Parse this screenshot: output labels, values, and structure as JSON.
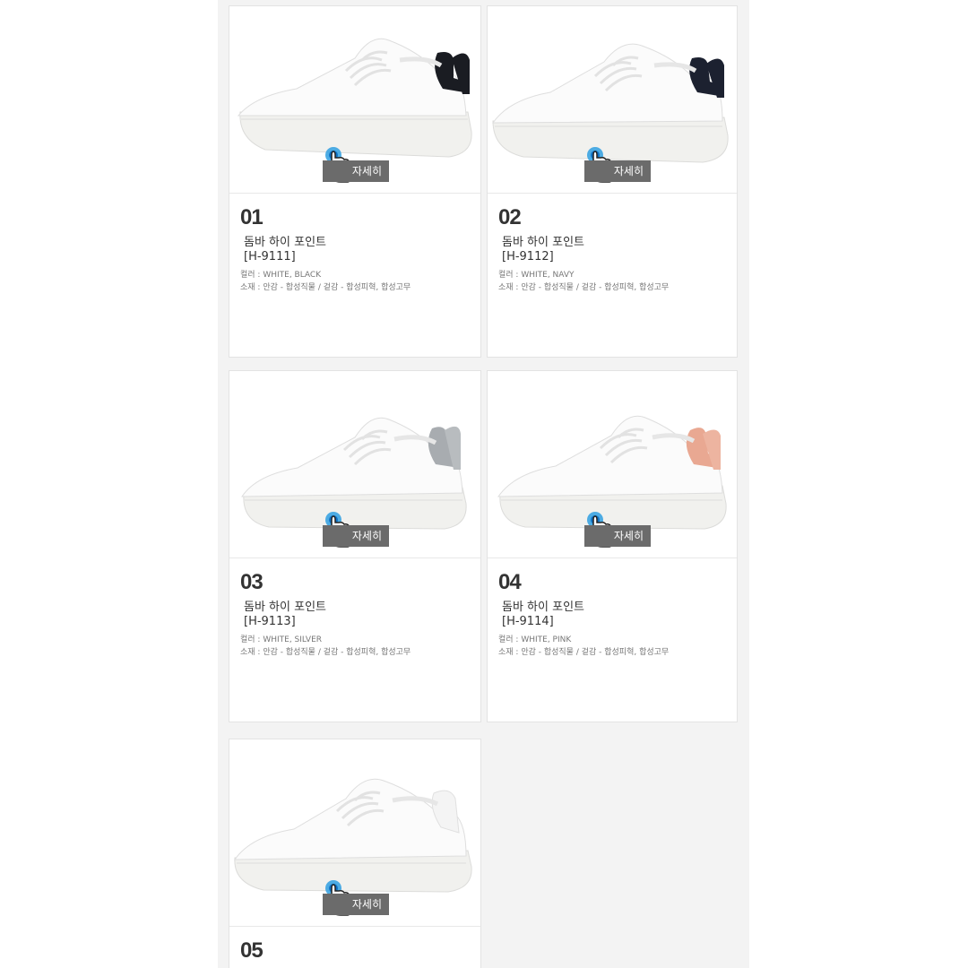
{
  "products": [
    {
      "number": "01",
      "name": "돔바 하이 포인트",
      "code": "[H-9111]",
      "color_label": "컬러 : WHITE, BLACK",
      "material_label": "소재 : 안감 - 합성직물 / 겉감 - 합성피혁, 합성고무",
      "accent": "#1a1c22"
    },
    {
      "number": "02",
      "name": "돔바 하이 포인트",
      "code": "[H-9112]",
      "color_label": "컬러 : WHITE, NAVY",
      "material_label": "소재 : 안감 - 합성직물 / 겉감 - 합성피혁, 합성고무",
      "accent": "#1c2130"
    },
    {
      "number": "03",
      "name": "돔바 하이 포인트",
      "code": "[H-9113]",
      "color_label": "컬러 :  WHITE, SILVER",
      "material_label": "소재 : 안감 - 합성직물 / 겉감 - 합성피혁, 합성고무",
      "accent": "#a8acb0"
    },
    {
      "number": "04",
      "name": "돔바 하이 포인트",
      "code": "[H-9114]",
      "color_label": "컬러 : WHITE, PINK",
      "material_label": "소재 : 안감 - 합성직물 / 겉감 - 합성피혁, 합성고무",
      "accent": "#e9a892"
    },
    {
      "number": "05",
      "name": "",
      "code": "",
      "color_label": "",
      "material_label": "",
      "accent": "#f2f2f2"
    }
  ],
  "detail_button_label": "자세히"
}
